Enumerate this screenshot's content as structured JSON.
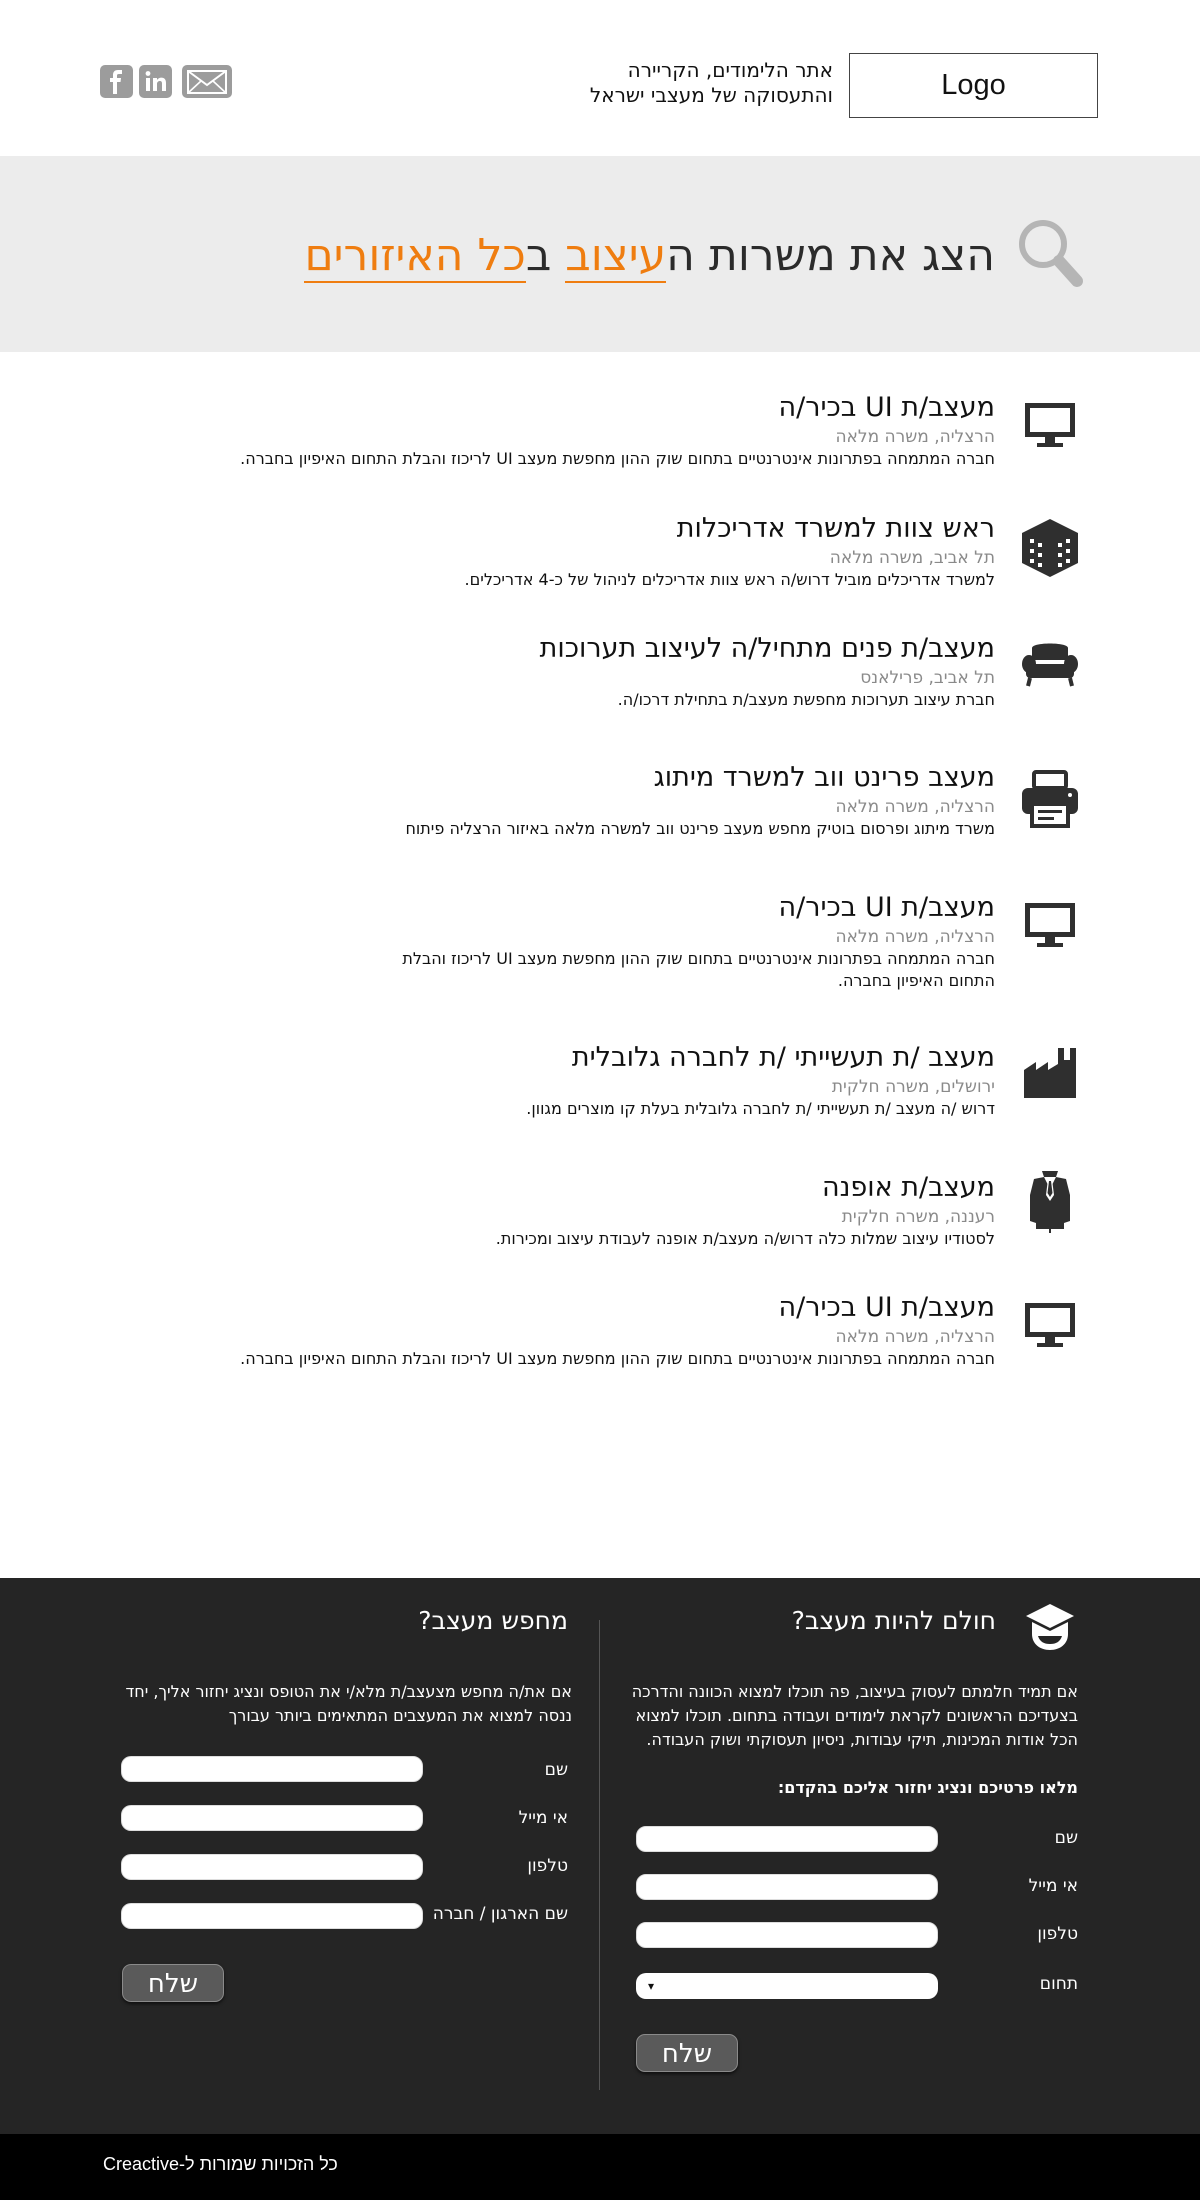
{
  "header": {
    "logo": "Logo",
    "tagline_line1": "אתר הלימודים, הקריירה",
    "tagline_line2": "והתעסוקה של מעצבי ישראל",
    "social_icons": [
      "facebook-icon",
      "linkedin-icon",
      "mail-icon"
    ]
  },
  "hero": {
    "part1": "הצג את משרות ה",
    "part2": "עיצוב",
    "part3": " ב",
    "part4": "כל האיזורים",
    "accent_color": "#ef7d10"
  },
  "jobs": [
    {
      "title": "מעצב/ת UI בכיר/ה",
      "meta": "הרצליה, משרה מלאה",
      "desc": "חברה המתמחה בפתרונות אינטרנטיים בתחום שוק ההון מחפשת מעצב UI לריכוז והבלת התחום האיפיון בחברה.",
      "icon": "monitor-icon"
    },
    {
      "title": "ראש צוות למשרד אדריכלות",
      "meta": "תל אביב, משרה מלאה",
      "desc": "למשרד אדריכלים מוביל דרוש/ה ראש צוות אדריכלים לניהול של כ-4 אדריכלים.",
      "icon": "building-icon"
    },
    {
      "title": "מעצב/ת פנים מתחיל/ה לעיצוב תערוכות",
      "meta": "תל אביב, פרילאנס",
      "desc": "חברת עיצוב תערוכות מחפשת מעצב/ת בתחילת דרכו/ה.",
      "icon": "armchair-icon"
    },
    {
      "title": "מעצב פרינט ווב למשרד מיתוג",
      "meta": "הרצליה, משרה מלאה",
      "desc": "משרד מיתוג ופרסום בוטיק מחפש מעצב פרינט ווב למשרה מלאה באיזור הרצליה פיתוח",
      "icon": "printer-icon"
    },
    {
      "title": "מעצב/ת UI בכיר/ה",
      "meta": "הרצליה, משרה מלאה",
      "desc": "חברה המתמחה בפתרונות אינטרנטיים בתחום שוק ההון מחפשת מעצב UI לריכוז והבלת התחום האיפיון בחברה.",
      "icon": "monitor-icon"
    },
    {
      "title": "מעצב /ת תעשייתי /ת לחברה גלובלית",
      "meta": "ירושלים, משרה חלקית",
      "desc": "דרוש /ה מעצב /ת תעשייתי /ת לחברה גלובלית בעלת קו מוצרים מגוון.",
      "icon": "factory-icon"
    },
    {
      "title": "מעצב/ת אופנה",
      "meta": "רעננה, משרה חלקית",
      "desc": "לסטודיו עיצוב שמלות כלה דרוש/ה מעצב/ת אופנה לעבודת עיצוב ומכירות.",
      "icon": "suit-icon"
    },
    {
      "title": "מעצב/ת UI בכיר/ה",
      "meta": "הרצליה, משרה מלאה",
      "desc": "חברה המתמחה בפתרונות אינטרנטיים בתחום שוק ההון מחפשת מעצב UI לריכוז והבלת התחום האיפיון בחברה.",
      "icon": "monitor-icon"
    }
  ],
  "dream": {
    "title": "חולם להיות מעצב?",
    "text": "אם תמיד חלמתם לעסוק בעיצוב, פה תוכלו למצוא הכוונה והדרכה בצעדיכם הראשונים לקראת לימודים ועבודה בתחום. תוכלו למצוא הכל אודות המכינות, תיקי עבודות, ניסיון תעסוקתי ושוק העבודה.",
    "subtitle": "מלאו פרטיכם ונציג יחזור אליכם בהקדם:",
    "fields": [
      "שם",
      "אי מייל",
      "טלפון",
      "תחום"
    ],
    "select_value": "▾",
    "send": "שלח"
  },
  "seeker": {
    "title": "מחפש מעצב?",
    "text": "אם את/ה מחפש מצעצב/ת מלא/י את הטופס ונציג יחזור אליך, יחד ננסה למצוא את המעצבים המתאימים ביותר עבורך",
    "fields": [
      "שם",
      "אי מייל",
      "טלפון",
      "שם הארגון / חברה"
    ],
    "send": "שלח"
  },
  "footer": {
    "copyright": "כל הזכויות שמורות ל-Creactive"
  }
}
